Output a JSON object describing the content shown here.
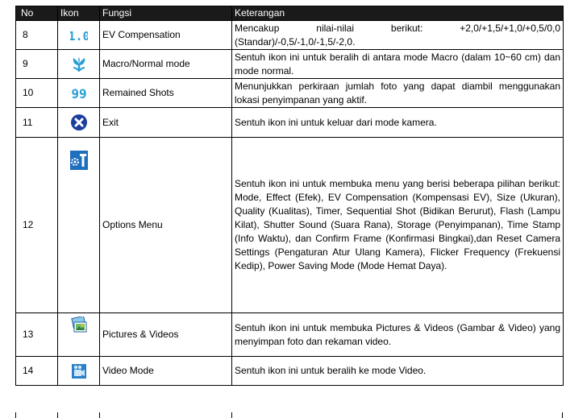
{
  "table": {
    "headers": {
      "no": "No",
      "icon": "Ikon",
      "function": "Fungsi",
      "description": "Keterangan"
    },
    "rows": [
      {
        "no": "8",
        "icon": "ev-compensation-icon",
        "function": "EV Compensation",
        "description": "Mencakup nilai-nilai berikut: +2,0/+1,5/+1,0/+0,5/0,0 (Standar)/-0,5/-1,0/-1,5/-2,0."
      },
      {
        "no": "9",
        "icon": "macro-flower-icon",
        "function": "Macro/Normal mode",
        "description": "Sentuh ikon ini untuk beralih di antara mode Macro (dalam 10~60 cm) dan mode normal."
      },
      {
        "no": "10",
        "icon": "remaining-shots-icon",
        "function": "Remained Shots",
        "description": "Menunjukkan perkiraan jumlah foto yang dapat diambil menggunakan lokasi penyimpanan yang aktif."
      },
      {
        "no": "11",
        "icon": "exit-icon",
        "function": "Exit",
        "description": "Sentuh ikon ini untuk keluar dari mode kamera."
      },
      {
        "no": "12",
        "icon": "options-menu-icon",
        "function": "Options Menu",
        "description": "Sentuh ikon ini untuk membuka menu yang berisi beberapa pilihan berikut: Mode, Effect (Efek), EV Compensation (Kompensasi EV), Size (Ukuran), Quality (Kualitas), Timer, Sequential Shot (Bidikan Berurut), Flash (Lampu Kilat), Shutter Sound (Suara Rana), Storage (Penyimpanan), Time Stamp (Info Waktu), dan Confirm Frame (Konfirmasi Bingkai),dan Reset Camera Settings (Pengaturan Atur Ulang Kamera), Flicker Frequency (Frekuensi Kedip), Power Saving Mode (Mode Hemat Daya)."
      },
      {
        "no": "13",
        "icon": "pictures-videos-icon",
        "function": "Pictures & Videos",
        "description": "Sentuh ikon ini untuk membuka Pictures & Videos (Gambar & Video) yang menyimpan foto dan rekaman video."
      },
      {
        "no": "14",
        "icon": "video-mode-icon",
        "function": "Video Mode",
        "description": "Sentuh ikon ini untuk beralih ke mode Video."
      }
    ],
    "ev_icon_text": "1.0",
    "remaining_icon_text": "99"
  }
}
